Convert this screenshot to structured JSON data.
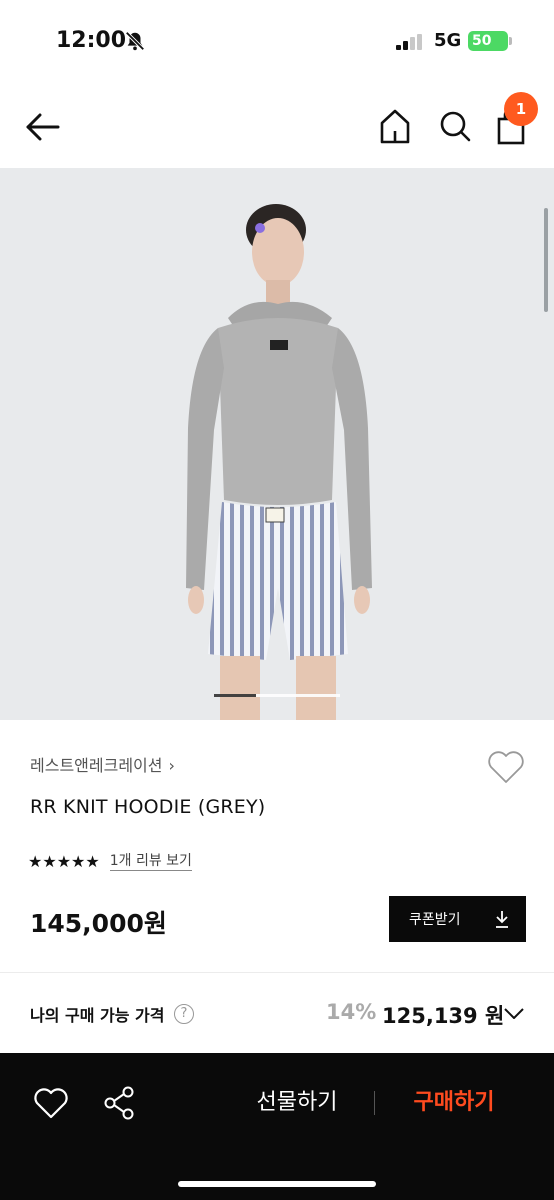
{
  "status_bar": {
    "time": "12:00",
    "network": "5G",
    "battery": "50"
  },
  "nav": {
    "cart_count": "1",
    "icons": [
      "back-arrow-icon",
      "home-icon",
      "search-icon",
      "shopping-bag-icon"
    ]
  },
  "product": {
    "brand": "레스트앤레크레이션",
    "brand_chevron": "›",
    "title": "RR KNIT HOODIE (GREY)",
    "stars": "★★★★★",
    "rating": 5,
    "review_link": "1개 리뷰 보기",
    "price": "145,000원",
    "coupon_label": "쿠폰받기"
  },
  "my_price": {
    "label": "나의 구매 가능 가격",
    "help": "?",
    "discount": "14%",
    "final_price": "125,139 원"
  },
  "bottom_bar": {
    "gift_label": "선물하기",
    "buy_label": "구매하기"
  },
  "colors": {
    "accent": "#ff4b1f",
    "badge": "#ff5a1f",
    "bottom_bar_bg": "#0a0a0a",
    "battery": "#4cd964"
  }
}
